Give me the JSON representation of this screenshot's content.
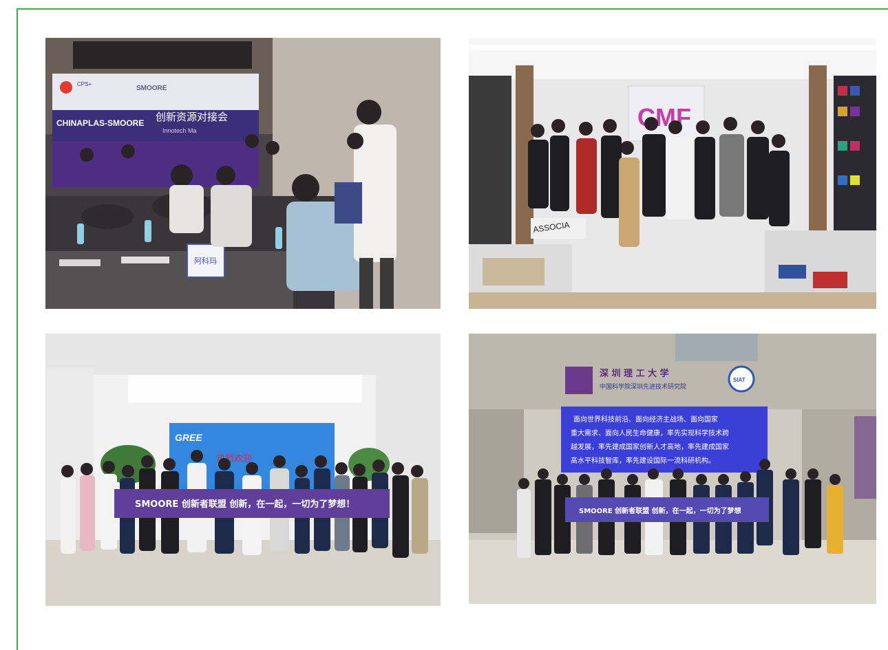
{
  "photos": [
    {
      "id": "matchmaking-event",
      "logo_text": "CPS+",
      "logo_brand": "SMOORE",
      "banner_title": "CHINAPLAS-SMOORE",
      "banner_cn": "创新资源对接会",
      "banner_sub": "Innotech Ma",
      "table_card": "阿科玛"
    },
    {
      "id": "showroom-group",
      "sign": "CMF",
      "box_label": "ASSOCIA"
    },
    {
      "id": "gree-group",
      "screen_brand": "GREE",
      "screen_welcome": "热烈欢迎",
      "banner": "SMOORE 创新者联盟   创新，在一起，一切为了梦想！"
    },
    {
      "id": "siat-group",
      "university": "深 圳 理 工 大 学",
      "institute": "中国科学院深圳先进技术研究院",
      "seal": "SIAT",
      "wall_text": [
        "面向世界科技前沿、面向经济主战场、面向国家",
        "重大需求、面向人民生命健康，率先实现科学技术跨",
        "越发展，率先建成国家创新人才高地，率先建成国家",
        "高水平科技智库，率先建设国际一流科研机构。"
      ],
      "banner": "SMOORE 创新者联盟   创新，在一起，一切为了梦想"
    }
  ]
}
